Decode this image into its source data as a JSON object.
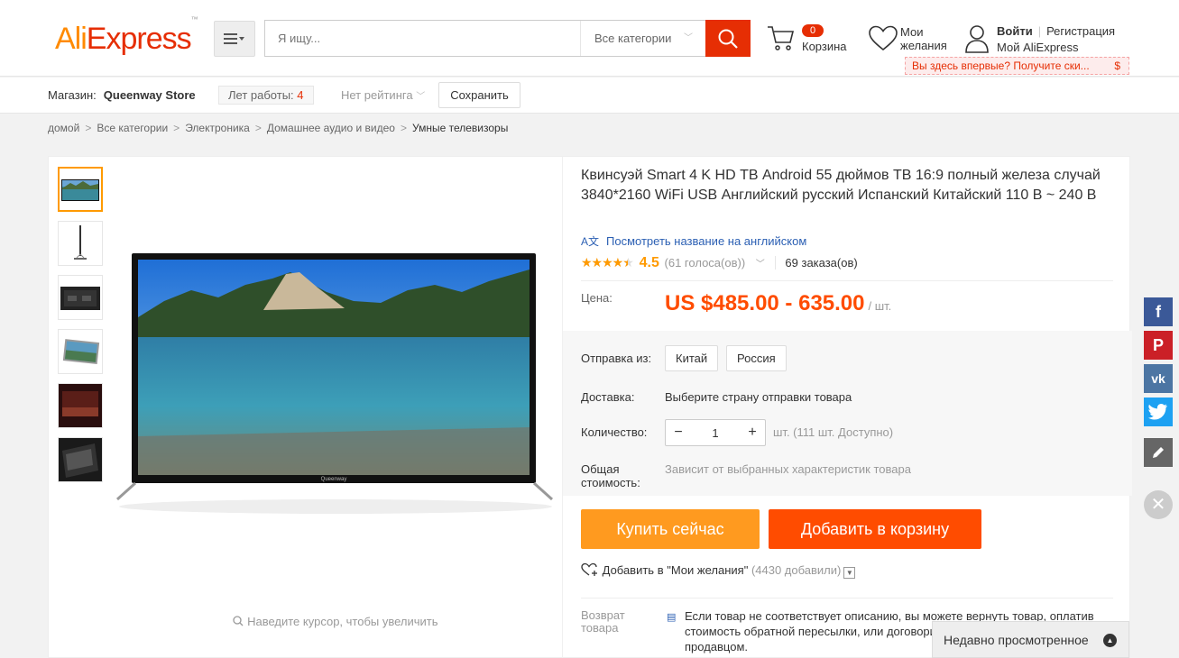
{
  "header": {
    "logo_ali": "Ali",
    "logo_express": "Express",
    "logo_tm": "™",
    "search_placeholder": "Я ищу...",
    "category_select": "Все категории",
    "cart_count": "0",
    "cart_label": "Корзина",
    "wishlist_line1": "Мои",
    "wishlist_line2": "желания",
    "login": "Войти",
    "register": "Регистрация",
    "my_account": "Мой AliExpress",
    "promo_text": "Вы здесь впервые? Получите ски...",
    "promo_dollar": "$"
  },
  "store": {
    "label": "Магазин:",
    "name": "Queenway Store",
    "years_label": "Лет работы:",
    "years_value": "4",
    "rating": "Нет рейтинга",
    "save_label": "Сохранить"
  },
  "breadcrumb": [
    "домой",
    "Все категории",
    "Электроника",
    "Домашнее аудио и видео",
    "Умные телевизоры"
  ],
  "gallery": {
    "zoom_hint": "Наведите курсор, чтобы увеличить",
    "tv_brand": "Queenway"
  },
  "product": {
    "title": "Квинсуэй Smart 4 K HD ТВ Android 55 дюймов ТВ 16:9 полный железа случай 3840*2160 WiFi USB Английский русский Испанский Китайский 110 В ~ 240 В",
    "translate_link": "Посмотреть название на английском",
    "rating_value": "4.5",
    "rating_fraction": 0.9,
    "votes": "(61 голоса(ов))",
    "orders": "69 заказа(ов)",
    "price_label": "Цена:",
    "price": "US $485.00 - 635.00",
    "price_unit": "/ шт.",
    "ship_from_label": "Отправка из:",
    "ship_from_options": [
      "Китай",
      "Россия"
    ],
    "delivery_label": "Доставка:",
    "delivery_value": "Выберите страну отправки товара",
    "quantity_label": "Количество:",
    "quantity_value": "1",
    "quantity_minus": "−",
    "quantity_plus": "+",
    "quantity_note": "шт. (111 шт. Доступно)",
    "total_label": "Общая стоимость:",
    "total_value": "Зависит от выбранных характеристик товара",
    "buy_now": "Купить сейчас",
    "add_to_cart": "Добавить в корзину",
    "wishlist_add": "Добавить в \"Мои желания\"",
    "wishlist_count": "(4430 добавили)",
    "return_label": "Возврат товара",
    "return_text": "Если товар не соответствует описанию, вы можете вернуть товар, оплатив стоимость обратной пересылки, или договориться о компенсации с продавцом."
  },
  "social": {
    "facebook_color": "#3b5998",
    "pinterest_color": "#cb2027",
    "vk_color": "#4c75a3",
    "twitter_color": "#1da1f2",
    "edit_color": "#666666"
  },
  "recently_viewed": "Недавно просмотренное"
}
